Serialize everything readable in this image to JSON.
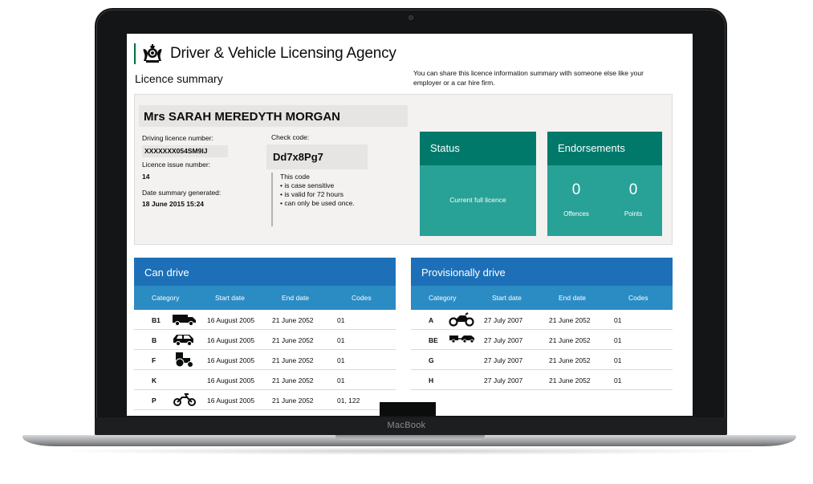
{
  "device": {
    "label": "MacBook"
  },
  "header": {
    "agency": "Driver & Vehicle Licensing Agency",
    "page_title": "Licence summary",
    "share_text": "You can share this licence information summary with someone else like your employer or a car hire firm."
  },
  "summary": {
    "holder_name": "Mrs SARAH MEREDYTH MORGAN",
    "licence_number_label": "Driving licence number:",
    "licence_number": "XXXXXXX054SM9IJ",
    "issue_number_label": "Licence issue number:",
    "issue_number": "14",
    "generated_label": "Date summary generated:",
    "generated": "18 June 2015 15:24",
    "check_code_label": "Check code:",
    "check_code": "Dd7x8Pg7",
    "code_note": [
      "This code",
      "• is case sensitive",
      "• is valid for 72 hours",
      "• can only be used once."
    ]
  },
  "status": {
    "title": "Status",
    "value": "Current full licence"
  },
  "endorsements": {
    "title": "Endorsements",
    "offences": "0",
    "offences_label": "Offences",
    "points": "0",
    "points_label": "Points"
  },
  "can_drive": {
    "title": "Can drive",
    "columns": [
      "Category",
      "Start date",
      "End date",
      "Codes"
    ],
    "rows": [
      {
        "cat": "B1",
        "icon": "van-icon",
        "start": "16 August 2005",
        "end": "21 June 2052",
        "codes": "01"
      },
      {
        "cat": "B",
        "icon": "car-icon",
        "start": "16 August 2005",
        "end": "21 June 2052",
        "codes": "01"
      },
      {
        "cat": "F",
        "icon": "tractor-icon",
        "start": "16 August 2005",
        "end": "21 June 2052",
        "codes": "01"
      },
      {
        "cat": "K",
        "icon": "",
        "start": "16 August 2005",
        "end": "21 June 2052",
        "codes": "01"
      },
      {
        "cat": "P",
        "icon": "moped-icon",
        "start": "16 August 2005",
        "end": "21 June 2052",
        "codes": "01, 122"
      }
    ]
  },
  "provisional": {
    "title": "Provisionally drive",
    "columns": [
      "Category",
      "Start date",
      "End date",
      "Codes"
    ],
    "rows": [
      {
        "cat": "A",
        "icon": "motorcycle-icon",
        "start": "27 July 2007",
        "end": "21 June 2052",
        "codes": "01"
      },
      {
        "cat": "BE",
        "icon": "car-trailer-icon",
        "start": "27 July 2007",
        "end": "21 June 2052",
        "codes": "01"
      },
      {
        "cat": "G",
        "icon": "",
        "start": "27 July 2007",
        "end": "21 June 2052",
        "codes": "01"
      },
      {
        "cat": "H",
        "icon": "",
        "start": "27 July 2007",
        "end": "21 June 2052",
        "codes": "01"
      }
    ]
  }
}
